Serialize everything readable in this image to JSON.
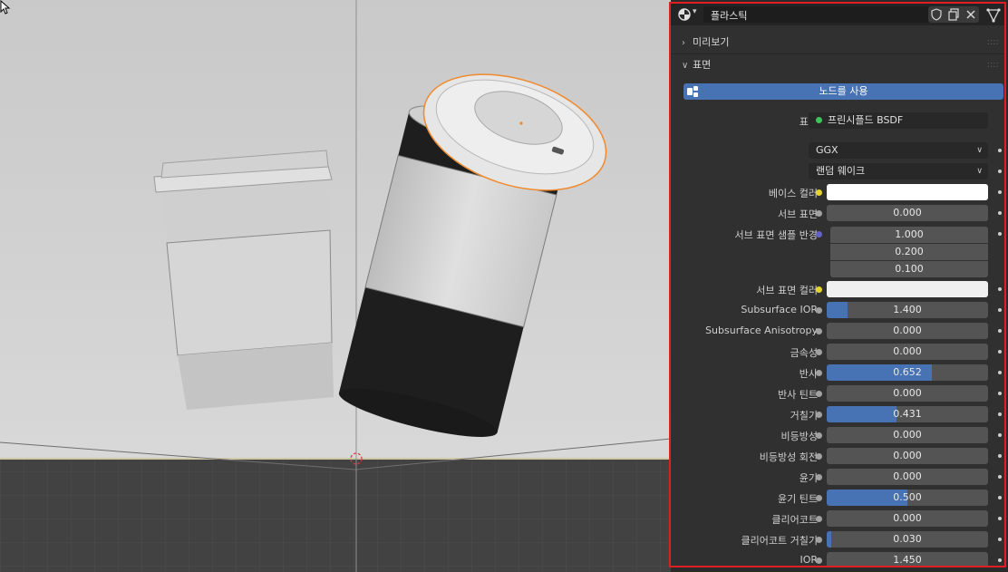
{
  "header": {
    "material_name": "플라스틱"
  },
  "sections": {
    "preview": "미리보기",
    "surface": "표면"
  },
  "use_nodes_label": "노드를 사용",
  "surface_row": {
    "label": "표면",
    "value": "프린시플드 BSDF"
  },
  "distribution": "GGX",
  "subsurface_method": "랜덤 웨이크",
  "params": {
    "base_color": {
      "label": "베이스 컬러"
    },
    "subsurface": {
      "label": "서브 표면",
      "value": "0.000",
      "fraction": 0
    },
    "subsurface_radius": {
      "label": "서브 표면 샘플 반경",
      "values": [
        "1.000",
        "0.200",
        "0.100"
      ]
    },
    "subsurface_color": {
      "label": "서브 표면 컬러"
    },
    "subsurface_ior": {
      "label": "Subsurface IOR",
      "value": "1.400",
      "fraction": 0.13
    },
    "subsurface_anisotropy": {
      "label": "Subsurface Anisotropy",
      "value": "0.000",
      "fraction": 0
    },
    "metallic": {
      "label": "금속성",
      "value": "0.000",
      "fraction": 0
    },
    "specular": {
      "label": "반사",
      "value": "0.652",
      "fraction": 0.652
    },
    "specular_tint": {
      "label": "반사 틴트",
      "value": "0.000",
      "fraction": 0
    },
    "roughness": {
      "label": "거칠기",
      "value": "0.431",
      "fraction": 0.431
    },
    "anisotropic": {
      "label": "비등방성",
      "value": "0.000",
      "fraction": 0
    },
    "anisotropic_rotation": {
      "label": "비등방성 회전",
      "value": "0.000",
      "fraction": 0
    },
    "sheen": {
      "label": "윤기",
      "value": "0.000",
      "fraction": 0
    },
    "sheen_tint": {
      "label": "윤기 틴트",
      "value": "0.500",
      "fraction": 0.5
    },
    "clearcoat": {
      "label": "클리어코트",
      "value": "0.000",
      "fraction": 0
    },
    "clearcoat_roughness": {
      "label": "클리어코트 거칠기",
      "value": "0.030",
      "fraction": 0.03
    },
    "ior": {
      "label": "IOR",
      "value": "1.450",
      "fraction": 0
    }
  },
  "colors": {
    "accent": "#4772b3",
    "highlight_border": "#e01e24",
    "selection_outline": "#f08a2c",
    "socket_color": "#e4d32c",
    "socket_vector": "#6363c7",
    "socket_shader": "#3fc25b"
  }
}
